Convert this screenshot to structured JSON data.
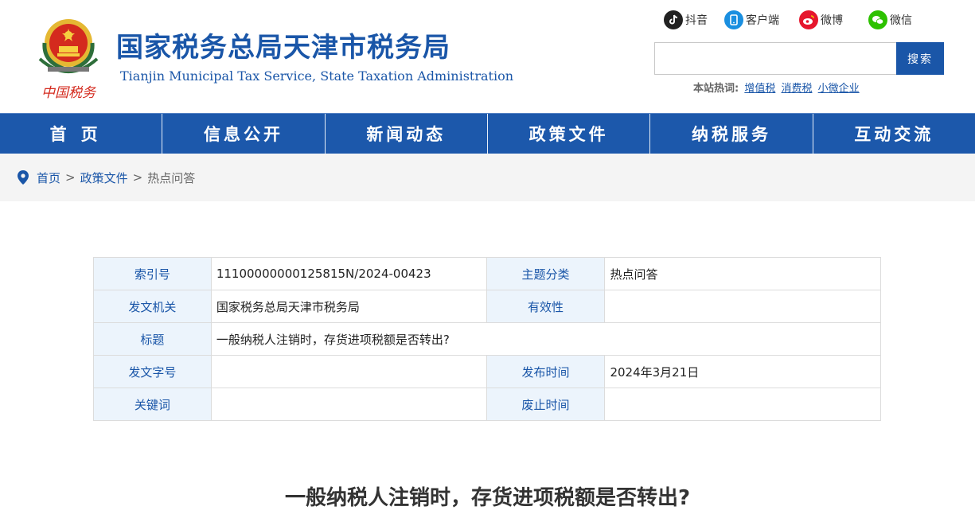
{
  "header": {
    "logo_text": "中国税务",
    "title": "国家税务总局天津市税务局",
    "subtitle": "Tianjin Municipal Tax Service, State Taxation Administration",
    "social": [
      {
        "label": "抖音",
        "icon": "douyin-icon",
        "color": "#222222"
      },
      {
        "label": "客户端",
        "icon": "mobile-app-icon",
        "color": "#1a8fe0"
      },
      {
        "label": "微博",
        "icon": "weibo-icon",
        "color": "#e6162d"
      },
      {
        "label": "微信",
        "icon": "wechat-icon",
        "color": "#2dc100"
      }
    ],
    "search": {
      "placeholder": "",
      "button": "搜索"
    },
    "hot": {
      "label": "本站热词:",
      "links": [
        "增值税",
        "消费税",
        "小微企业"
      ]
    }
  },
  "nav": {
    "items": [
      "首页",
      "信息公开",
      "新闻动态",
      "政策文件",
      "纳税服务",
      "互动交流"
    ]
  },
  "breadcrumb": {
    "home": "首页",
    "sep": ">",
    "section": "政策文件",
    "current": "热点问答"
  },
  "info": {
    "index_label": "索引号",
    "index_value": "11100000000125815N/2024-00423",
    "topic_label": "主题分类",
    "topic_value": "热点问答",
    "issuer_label": "发文机关",
    "issuer_value": "国家税务总局天津市税务局",
    "validity_label": "有效性",
    "validity_value": "",
    "title_label": "标题",
    "title_value": "一般纳税人注销时，存货进项税额是否转出?",
    "docno_label": "发文字号",
    "docno_value": "",
    "pubdate_label": "发布时间",
    "pubdate_value": "2024年3月21日",
    "keywords_label": "关键词",
    "keywords_value": "",
    "expire_label": "废止时间",
    "expire_value": ""
  },
  "article": {
    "title": "一般纳税人注销时，存货进项税额是否转出?"
  },
  "colors": {
    "brand_blue": "#1a56a8",
    "nav_blue": "#1c58ab",
    "label_bg": "#ecf4fc"
  }
}
